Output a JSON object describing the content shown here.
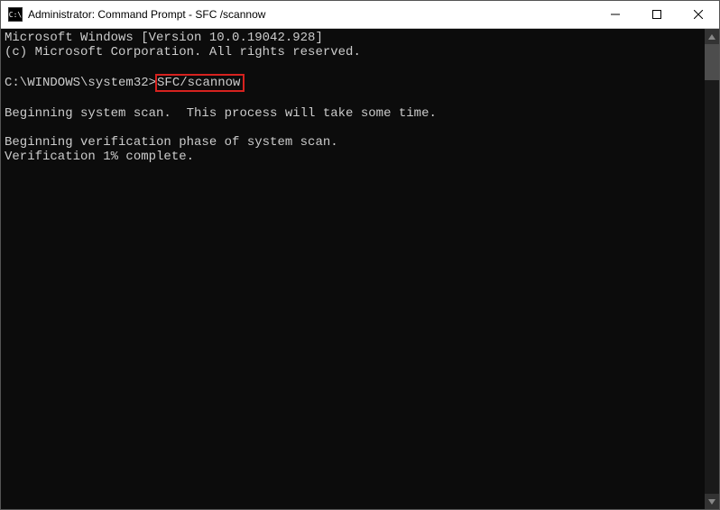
{
  "titlebar": {
    "icon_label": "C:\\",
    "title": "Administrator: Command Prompt - SFC /scannow"
  },
  "terminal": {
    "line1": "Microsoft Windows [Version 10.0.19042.928]",
    "line2": "(c) Microsoft Corporation. All rights reserved.",
    "blank1": "",
    "prompt_prefix": "C:\\WINDOWS\\system32>",
    "command": "SFC/scannow",
    "blank2": "",
    "line3": "Beginning system scan.  This process will take some time.",
    "blank3": "",
    "line4": "Beginning verification phase of system scan.",
    "line5": "Verification 1% complete."
  }
}
